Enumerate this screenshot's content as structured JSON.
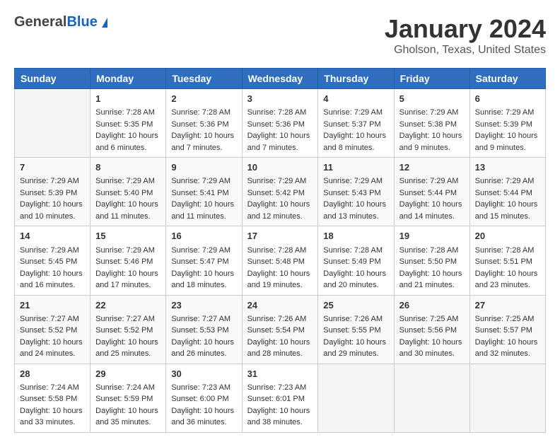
{
  "header": {
    "logo_general": "General",
    "logo_blue": "Blue",
    "title": "January 2024",
    "subtitle": "Gholson, Texas, United States"
  },
  "columns": [
    "Sunday",
    "Monday",
    "Tuesday",
    "Wednesday",
    "Thursday",
    "Friday",
    "Saturday"
  ],
  "weeks": [
    [
      {
        "day": "",
        "sunrise": "",
        "sunset": "",
        "daylight": ""
      },
      {
        "day": "1",
        "sunrise": "Sunrise: 7:28 AM",
        "sunset": "Sunset: 5:35 PM",
        "daylight": "Daylight: 10 hours and 6 minutes."
      },
      {
        "day": "2",
        "sunrise": "Sunrise: 7:28 AM",
        "sunset": "Sunset: 5:36 PM",
        "daylight": "Daylight: 10 hours and 7 minutes."
      },
      {
        "day": "3",
        "sunrise": "Sunrise: 7:28 AM",
        "sunset": "Sunset: 5:36 PM",
        "daylight": "Daylight: 10 hours and 7 minutes."
      },
      {
        "day": "4",
        "sunrise": "Sunrise: 7:29 AM",
        "sunset": "Sunset: 5:37 PM",
        "daylight": "Daylight: 10 hours and 8 minutes."
      },
      {
        "day": "5",
        "sunrise": "Sunrise: 7:29 AM",
        "sunset": "Sunset: 5:38 PM",
        "daylight": "Daylight: 10 hours and 9 minutes."
      },
      {
        "day": "6",
        "sunrise": "Sunrise: 7:29 AM",
        "sunset": "Sunset: 5:39 PM",
        "daylight": "Daylight: 10 hours and 9 minutes."
      }
    ],
    [
      {
        "day": "7",
        "sunrise": "Sunrise: 7:29 AM",
        "sunset": "Sunset: 5:39 PM",
        "daylight": "Daylight: 10 hours and 10 minutes."
      },
      {
        "day": "8",
        "sunrise": "Sunrise: 7:29 AM",
        "sunset": "Sunset: 5:40 PM",
        "daylight": "Daylight: 10 hours and 11 minutes."
      },
      {
        "day": "9",
        "sunrise": "Sunrise: 7:29 AM",
        "sunset": "Sunset: 5:41 PM",
        "daylight": "Daylight: 10 hours and 11 minutes."
      },
      {
        "day": "10",
        "sunrise": "Sunrise: 7:29 AM",
        "sunset": "Sunset: 5:42 PM",
        "daylight": "Daylight: 10 hours and 12 minutes."
      },
      {
        "day": "11",
        "sunrise": "Sunrise: 7:29 AM",
        "sunset": "Sunset: 5:43 PM",
        "daylight": "Daylight: 10 hours and 13 minutes."
      },
      {
        "day": "12",
        "sunrise": "Sunrise: 7:29 AM",
        "sunset": "Sunset: 5:44 PM",
        "daylight": "Daylight: 10 hours and 14 minutes."
      },
      {
        "day": "13",
        "sunrise": "Sunrise: 7:29 AM",
        "sunset": "Sunset: 5:44 PM",
        "daylight": "Daylight: 10 hours and 15 minutes."
      }
    ],
    [
      {
        "day": "14",
        "sunrise": "Sunrise: 7:29 AM",
        "sunset": "Sunset: 5:45 PM",
        "daylight": "Daylight: 10 hours and 16 minutes."
      },
      {
        "day": "15",
        "sunrise": "Sunrise: 7:29 AM",
        "sunset": "Sunset: 5:46 PM",
        "daylight": "Daylight: 10 hours and 17 minutes."
      },
      {
        "day": "16",
        "sunrise": "Sunrise: 7:29 AM",
        "sunset": "Sunset: 5:47 PM",
        "daylight": "Daylight: 10 hours and 18 minutes."
      },
      {
        "day": "17",
        "sunrise": "Sunrise: 7:28 AM",
        "sunset": "Sunset: 5:48 PM",
        "daylight": "Daylight: 10 hours and 19 minutes."
      },
      {
        "day": "18",
        "sunrise": "Sunrise: 7:28 AM",
        "sunset": "Sunset: 5:49 PM",
        "daylight": "Daylight: 10 hours and 20 minutes."
      },
      {
        "day": "19",
        "sunrise": "Sunrise: 7:28 AM",
        "sunset": "Sunset: 5:50 PM",
        "daylight": "Daylight: 10 hours and 21 minutes."
      },
      {
        "day": "20",
        "sunrise": "Sunrise: 7:28 AM",
        "sunset": "Sunset: 5:51 PM",
        "daylight": "Daylight: 10 hours and 23 minutes."
      }
    ],
    [
      {
        "day": "21",
        "sunrise": "Sunrise: 7:27 AM",
        "sunset": "Sunset: 5:52 PM",
        "daylight": "Daylight: 10 hours and 24 minutes."
      },
      {
        "day": "22",
        "sunrise": "Sunrise: 7:27 AM",
        "sunset": "Sunset: 5:52 PM",
        "daylight": "Daylight: 10 hours and 25 minutes."
      },
      {
        "day": "23",
        "sunrise": "Sunrise: 7:27 AM",
        "sunset": "Sunset: 5:53 PM",
        "daylight": "Daylight: 10 hours and 26 minutes."
      },
      {
        "day": "24",
        "sunrise": "Sunrise: 7:26 AM",
        "sunset": "Sunset: 5:54 PM",
        "daylight": "Daylight: 10 hours and 28 minutes."
      },
      {
        "day": "25",
        "sunrise": "Sunrise: 7:26 AM",
        "sunset": "Sunset: 5:55 PM",
        "daylight": "Daylight: 10 hours and 29 minutes."
      },
      {
        "day": "26",
        "sunrise": "Sunrise: 7:25 AM",
        "sunset": "Sunset: 5:56 PM",
        "daylight": "Daylight: 10 hours and 30 minutes."
      },
      {
        "day": "27",
        "sunrise": "Sunrise: 7:25 AM",
        "sunset": "Sunset: 5:57 PM",
        "daylight": "Daylight: 10 hours and 32 minutes."
      }
    ],
    [
      {
        "day": "28",
        "sunrise": "Sunrise: 7:24 AM",
        "sunset": "Sunset: 5:58 PM",
        "daylight": "Daylight: 10 hours and 33 minutes."
      },
      {
        "day": "29",
        "sunrise": "Sunrise: 7:24 AM",
        "sunset": "Sunset: 5:59 PM",
        "daylight": "Daylight: 10 hours and 35 minutes."
      },
      {
        "day": "30",
        "sunrise": "Sunrise: 7:23 AM",
        "sunset": "Sunset: 6:00 PM",
        "daylight": "Daylight: 10 hours and 36 minutes."
      },
      {
        "day": "31",
        "sunrise": "Sunrise: 7:23 AM",
        "sunset": "Sunset: 6:01 PM",
        "daylight": "Daylight: 10 hours and 38 minutes."
      },
      {
        "day": "",
        "sunrise": "",
        "sunset": "",
        "daylight": ""
      },
      {
        "day": "",
        "sunrise": "",
        "sunset": "",
        "daylight": ""
      },
      {
        "day": "",
        "sunrise": "",
        "sunset": "",
        "daylight": ""
      }
    ]
  ]
}
